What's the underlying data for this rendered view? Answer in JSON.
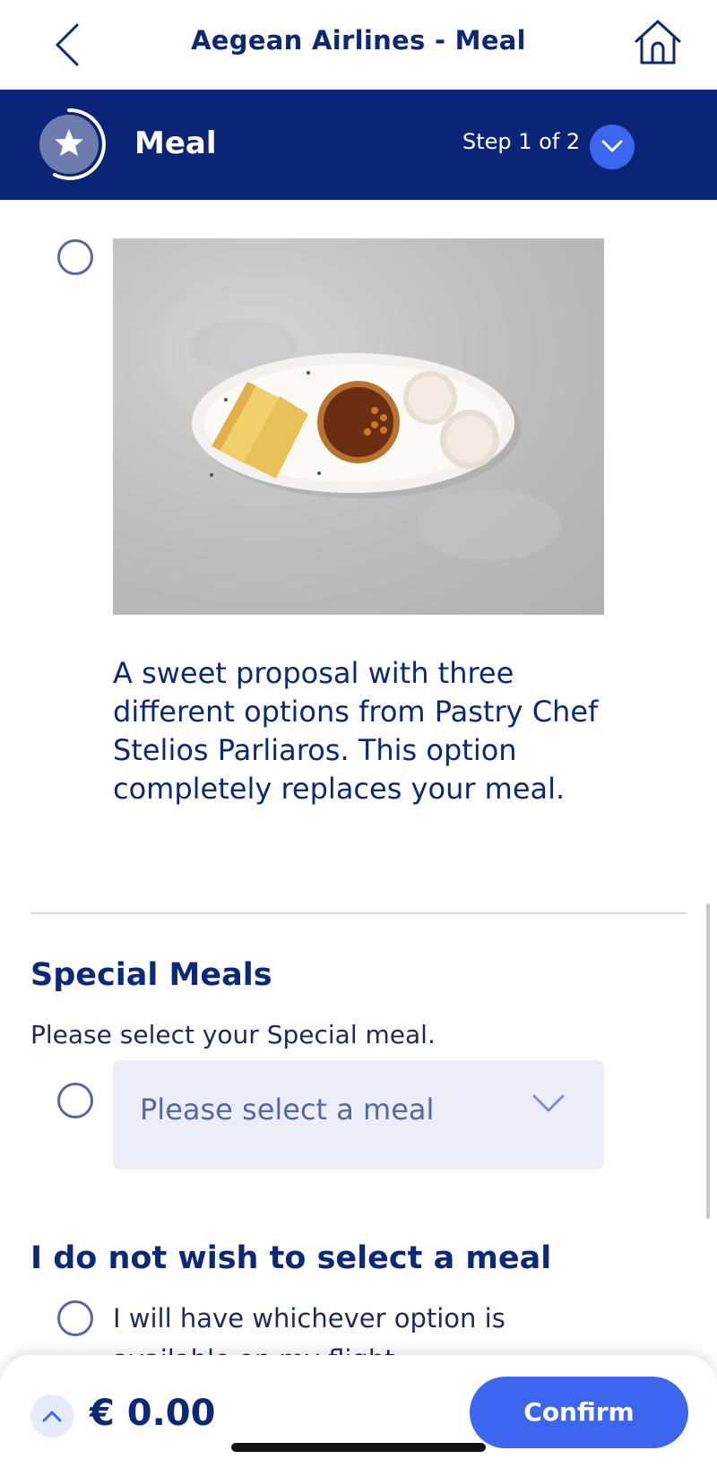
{
  "header": {
    "title": "Aegean Airlines - Meal",
    "back_icon": "chevron-left-icon",
    "home_icon": "home-icon"
  },
  "step": {
    "label": "Meal",
    "progress": "Step 1 of 2",
    "icon": "star-icon",
    "toggle_icon": "chevron-down-icon"
  },
  "meal_option": {
    "description": "A sweet proposal with three different options from Pastry Chef Stelios Parliaros. This option completely replaces your meal.",
    "selected": false
  },
  "special_meals": {
    "title": "Special Meals",
    "subtitle": "Please select your Special meal.",
    "select_placeholder": "Please select a meal",
    "selected": false
  },
  "no_meal": {
    "title": "I do not wish to select a meal",
    "option_text": "I will have whichever option is",
    "option_text_cut": "available on my flight",
    "selected": false
  },
  "footer": {
    "total": "€ 0.00",
    "confirm_label": "Confirm"
  },
  "colors": {
    "brand_navy": "#0a2577",
    "accent_blue": "#3c66f0",
    "text_navy": "#0c2878"
  }
}
